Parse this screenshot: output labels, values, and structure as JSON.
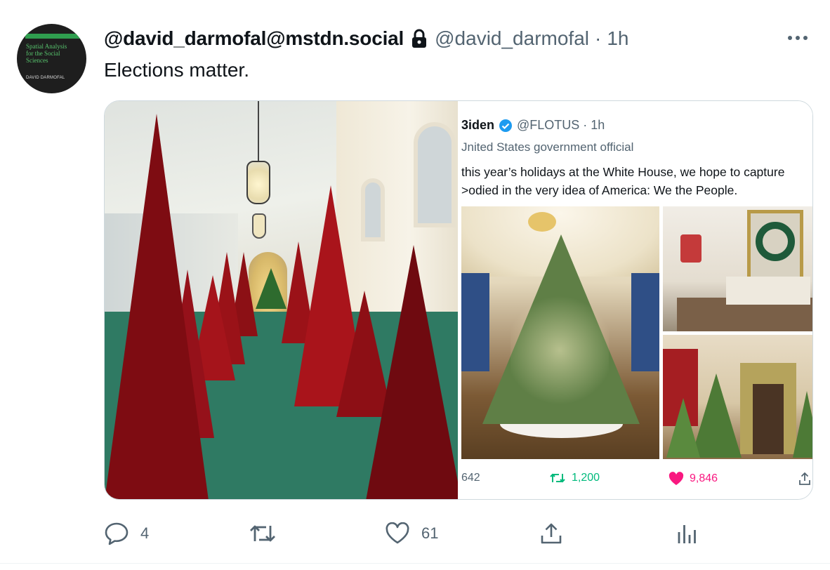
{
  "avatar": {
    "book_title": "Spatial Analysis for the Social Sciences",
    "book_title_lines": [
      "Spatial Analysis",
      "for the Social",
      "Sciences"
    ],
    "book_author": "DAVID DARMOFAL"
  },
  "tweet": {
    "display_name": "@david_darmofal@mstdn.social",
    "handle": "@david_darmofal",
    "separator": "·",
    "time": "1h",
    "text": "Elections matter.",
    "protected_icon": "lock-icon",
    "more_icon": "more-dots-icon"
  },
  "embedded": {
    "name": "3iden",
    "handle": "@FLOTUS",
    "separator": "·",
    "time": "1h",
    "label": "Jnited States government official",
    "body_lines": [
      "this year’s holidays at the White House, we hope to capture",
      ">odied in the very idea of America: We the People."
    ],
    "replies": "642",
    "retweets": "1,200",
    "likes": "9,846"
  },
  "actions": {
    "reply_count": "4",
    "retweet_count": "",
    "like_count": "61",
    "icons": [
      "reply-icon",
      "retweet-icon",
      "like-icon",
      "share-icon",
      "analytics-icon"
    ]
  },
  "colors": {
    "text": "#0f1419",
    "secondary": "#536471",
    "retweet_green": "#00ba7c",
    "like_pink": "#f91880",
    "verified_blue": "#1d9bf0"
  }
}
